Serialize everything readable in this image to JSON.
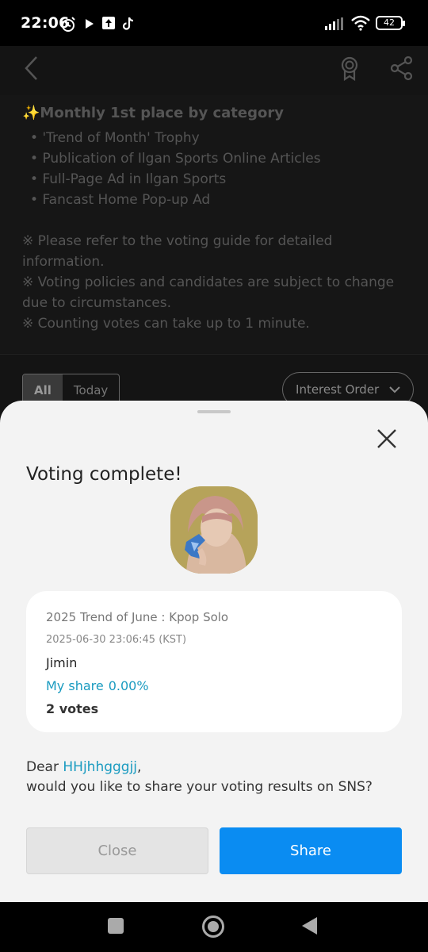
{
  "status_bar": {
    "time": "22:06",
    "battery": "42"
  },
  "info": {
    "heading_icon": "✨",
    "heading": "Monthly 1st place by category",
    "benefits": [
      "'Trend of Month' Trophy",
      "Publication of Ilgan Sports Online Articles",
      "Full-Page Ad in Ilgan Sports",
      "Fancast Home Pop-up Ad"
    ],
    "notes": [
      "※ Please refer to the voting guide for detailed information.",
      "※ Voting policies and candidates are subject to change due to circumstances.",
      "※ Counting votes can take up to 1 minute."
    ]
  },
  "filters": {
    "tab_all": "All",
    "tab_today": "Today",
    "order": "Interest Order"
  },
  "sheet": {
    "title": "Voting complete!",
    "event": "2025 Trend of June : Kpop Solo",
    "datetime": "2025-06-30 23:06:45 (KST)",
    "candidate": "Jimin",
    "share_label": "My share",
    "share_value": "0.00%",
    "votes": "2 votes",
    "dear": "Dear ",
    "username": "HHjhhgggjj",
    "comma": ",",
    "question": "would you like to share your voting results on SNS?",
    "close_label": "Close",
    "share_button": "Share"
  },
  "colors": {
    "accent": "#0a8cf2",
    "link": "#1a9bc0"
  },
  "icons": [
    "alarm-icon",
    "play-icon",
    "upload-icon",
    "tiktok-icon",
    "signal-icon",
    "wifi-icon",
    "battery-icon",
    "back-icon",
    "award-icon",
    "share-icon",
    "close-icon"
  ]
}
